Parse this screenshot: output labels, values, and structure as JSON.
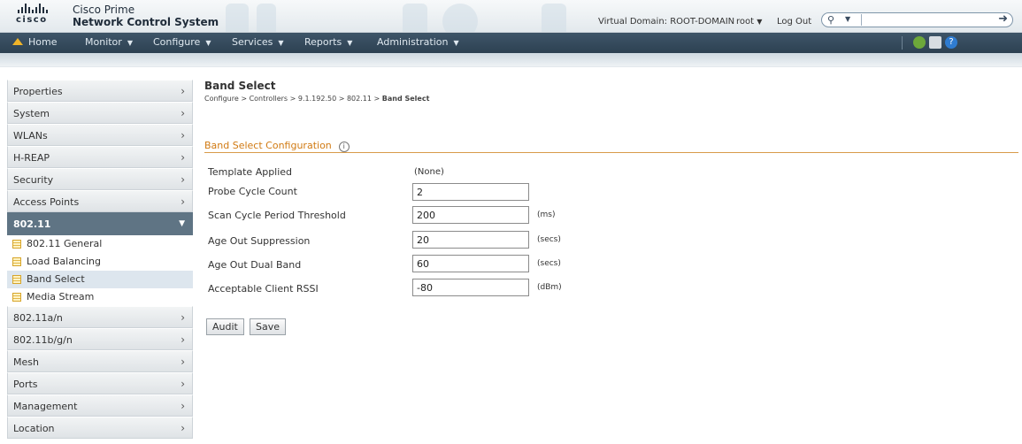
{
  "header": {
    "logo_text": "cisco",
    "product_line1": "Cisco Prime",
    "product_line2": "Network Control System",
    "virtual_domain": "Virtual Domain: ROOT-DOMAIN",
    "user": "root",
    "logout": "Log Out",
    "search_value": ""
  },
  "menu": [
    {
      "label": "Home",
      "icon": "home-icon"
    },
    {
      "label": "Monitor"
    },
    {
      "label": "Configure"
    },
    {
      "label": "Services"
    },
    {
      "label": "Reports"
    },
    {
      "label": "Administration"
    }
  ],
  "toolbar_icons": [
    "gear-icon",
    "print-icon",
    "help-icon"
  ],
  "sidebar": {
    "items_top": [
      "Properties",
      "System",
      "WLANs",
      "H-REAP",
      "Security",
      "Access Points"
    ],
    "open_item": "802.11",
    "sub_items": [
      "802.11 General",
      "Load Balancing",
      "Band Select",
      "Media Stream"
    ],
    "selected_sub": "Band Select",
    "items_bottom": [
      "802.11a/n",
      "802.11b/g/n",
      "Mesh",
      "Ports",
      "Management",
      "Location"
    ]
  },
  "main": {
    "title": "Band Select",
    "breadcrumb": [
      "Configure",
      "Controllers",
      "9.1.192.50",
      "802.11",
      "Band Select"
    ],
    "section_title": "Band Select Configuration",
    "template_label": "Template Applied",
    "template_value": "(None)",
    "fields": [
      {
        "label": "Probe Cycle Count",
        "value": "2",
        "unit": ""
      },
      {
        "label": "Scan Cycle Period Threshold",
        "value": "200",
        "unit": "(ms)"
      },
      {
        "label": "Age Out Suppression",
        "value": "20",
        "unit": "(secs)"
      },
      {
        "label": "Age Out Dual Band",
        "value": "60",
        "unit": "(secs)"
      },
      {
        "label": "Acceptable Client RSSI",
        "value": "-80",
        "unit": "(dBm)"
      }
    ],
    "buttons": {
      "audit": "Audit",
      "save": "Save"
    }
  },
  "colors": {
    "menu_bg": "#34495a",
    "section_title": "#d17a12",
    "sidebar_open": "#5f7484",
    "sidebar_selected": "#dde6ee"
  }
}
